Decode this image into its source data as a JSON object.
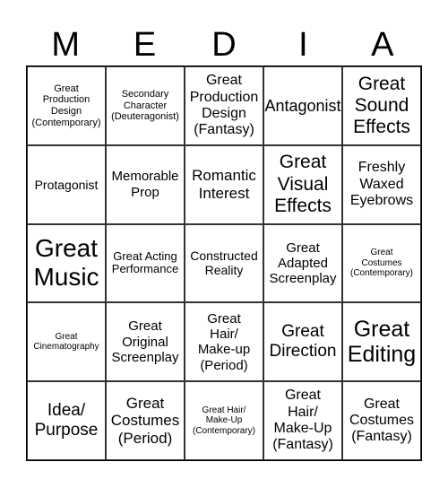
{
  "header": [
    "M",
    "E",
    "D",
    "I",
    "A"
  ],
  "cells": [
    "Great\nProduction\nDesign\n(Contemporary)",
    "Secondary\nCharacter\n(Deuteragonist)",
    "Great\nProduction\nDesign\n(Fantasy)",
    "Antagonist",
    "Great\nSound\nEffects",
    "Protagonist",
    "Memorable\nProp",
    "Romantic\nInterest",
    "Great\nVisual\nEffects",
    "Freshly\nWaxed\nEyebrows",
    "Great\nMusic",
    "Great Acting\nPerformance",
    "Constructed\nReality",
    "Great\nAdapted\nScreenplay",
    "Great\nCostumes\n(Contemporary)",
    "Great\nCinematography",
    "Great\nOriginal\nScreenplay",
    "Great\nHair/\nMake-up\n(Period)",
    "Great\nDirection",
    "Great\nEditing",
    "Idea/\nPurpose",
    "Great\nCostumes\n(Period)",
    "Great Hair/\nMake-Up\n(Contemporary)",
    "Great\nHair/\nMake-Up\n(Fantasy)",
    "Great\nCostumes\n(Fantasy)"
  ]
}
